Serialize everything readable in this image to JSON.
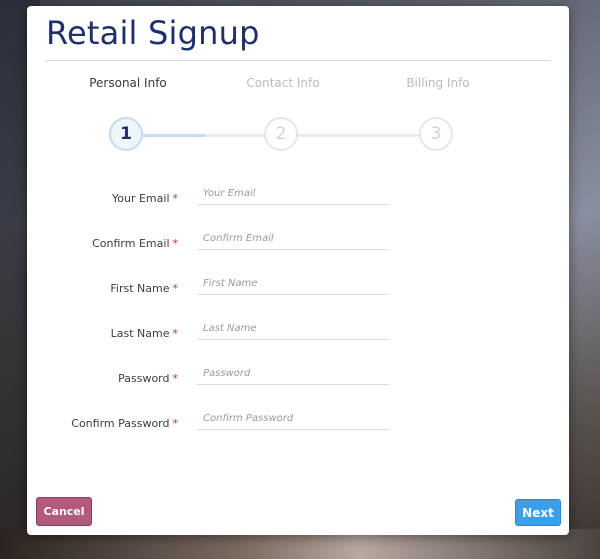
{
  "form": {
    "title": "Retail Signup",
    "steps": [
      {
        "label": "Personal Info",
        "number": "1",
        "state": "active"
      },
      {
        "label": "Contact Info",
        "number": "2",
        "state": "inactive"
      },
      {
        "label": "Billing Info",
        "number": "3",
        "state": "inactive"
      }
    ],
    "required_marker": "*",
    "fields": [
      {
        "label": "Your Email",
        "placeholder": "Your Email",
        "value": ""
      },
      {
        "label": "Confirm Email",
        "placeholder": "Confirm Email",
        "value": ""
      },
      {
        "label": "First Name",
        "placeholder": "First Name",
        "value": ""
      },
      {
        "label": "Last Name",
        "placeholder": "Last Name",
        "value": ""
      },
      {
        "label": "Password",
        "placeholder": "Password",
        "value": ""
      },
      {
        "label": "Confirm Password",
        "placeholder": "Confirm Password",
        "value": ""
      }
    ]
  },
  "buttons": {
    "cancel_label": "Cancel",
    "next_label": "Next"
  },
  "colors": {
    "title": "#1f2f6b",
    "required": "#d0312d",
    "cancel_bg": "#b35a7a",
    "next_bg": "#3aa0ee"
  }
}
